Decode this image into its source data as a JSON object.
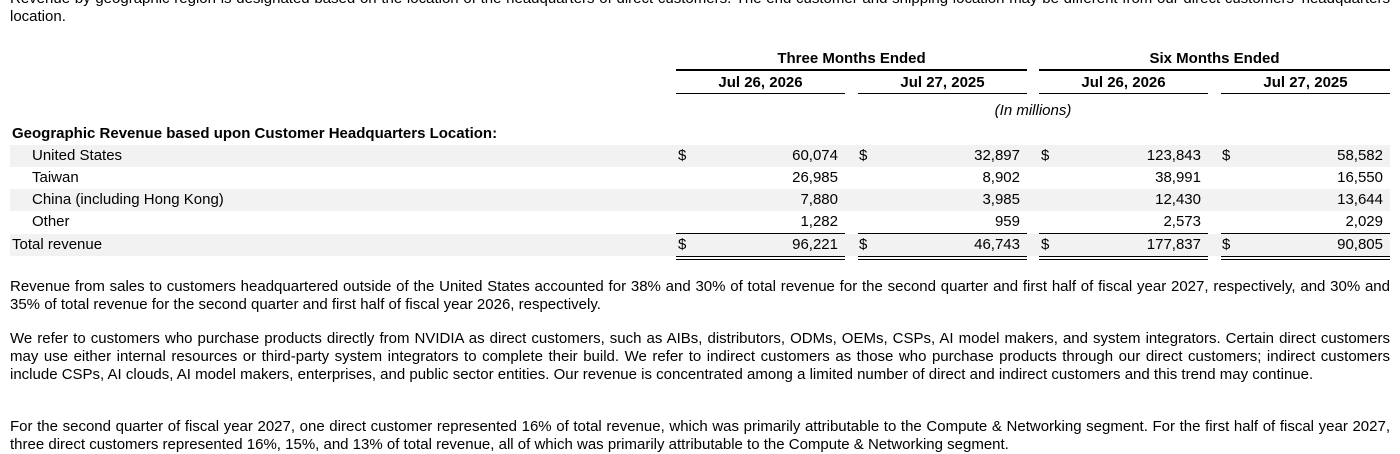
{
  "paragraphs": {
    "intro": "Revenue by geographic region is designated based on the location of the headquarters of direct customers. The end customer and shipping location may be different from our direct customers' headquarters location.",
    "p1": "Revenue from sales to customers headquartered outside of the United States accounted for 38% and 30% of total revenue for the second quarter and first half of fiscal year 2027, respectively, and 30% and 35% of total revenue for the second quarter and first half of fiscal year 2026, respectively.",
    "p2": "We refer to customers who purchase products directly from NVIDIA as direct customers, such as AIBs, distributors, ODMs, OEMs, CSPs, AI model makers, and system integrators. Certain direct customers may use either internal resources or third-party system integrators to complete their build. We refer to indirect customers as those who purchase products through our direct customers; indirect customers include CSPs, AI clouds, AI model makers, enterprises, and public sector entities. Our revenue is concentrated among a limited number of direct and indirect customers and this trend may continue.",
    "p3": "For the second quarter of fiscal year 2027, one direct customer represented 16% of total revenue, which was primarily attributable to the Compute & Networking segment. For the first half of fiscal year 2027, three direct customers represented 16%, 15%, and 13% of total revenue, all of which was primarily attributable to the Compute & Networking segment."
  },
  "table": {
    "group_headers": [
      "Three Months Ended",
      "Six Months Ended"
    ],
    "column_headers": [
      "Jul 26, 2026",
      "Jul 27, 2025",
      "Jul 26, 2026",
      "Jul 27, 2025"
    ],
    "units": "(In millions)",
    "section_title": "Geographic Revenue based upon Customer Headquarters Location:",
    "currency_symbol": "$",
    "rows": [
      {
        "label": "United States",
        "values": [
          "60,074",
          "32,897",
          "123,843",
          "58,582"
        ]
      },
      {
        "label": "Taiwan",
        "values": [
          "26,985",
          "8,902",
          "38,991",
          "16,550"
        ]
      },
      {
        "label": "China (including Hong Kong)",
        "values": [
          "7,880",
          "3,985",
          "12,430",
          "13,644"
        ]
      },
      {
        "label": "Other",
        "values": [
          "1,282",
          "959",
          "2,573",
          "2,029"
        ]
      }
    ],
    "total": {
      "label": "Total revenue",
      "values": [
        "96,221",
        "46,743",
        "177,837",
        "90,805"
      ]
    }
  },
  "colors": {
    "row_shade": "#f2f2f2",
    "text": "#000000"
  }
}
